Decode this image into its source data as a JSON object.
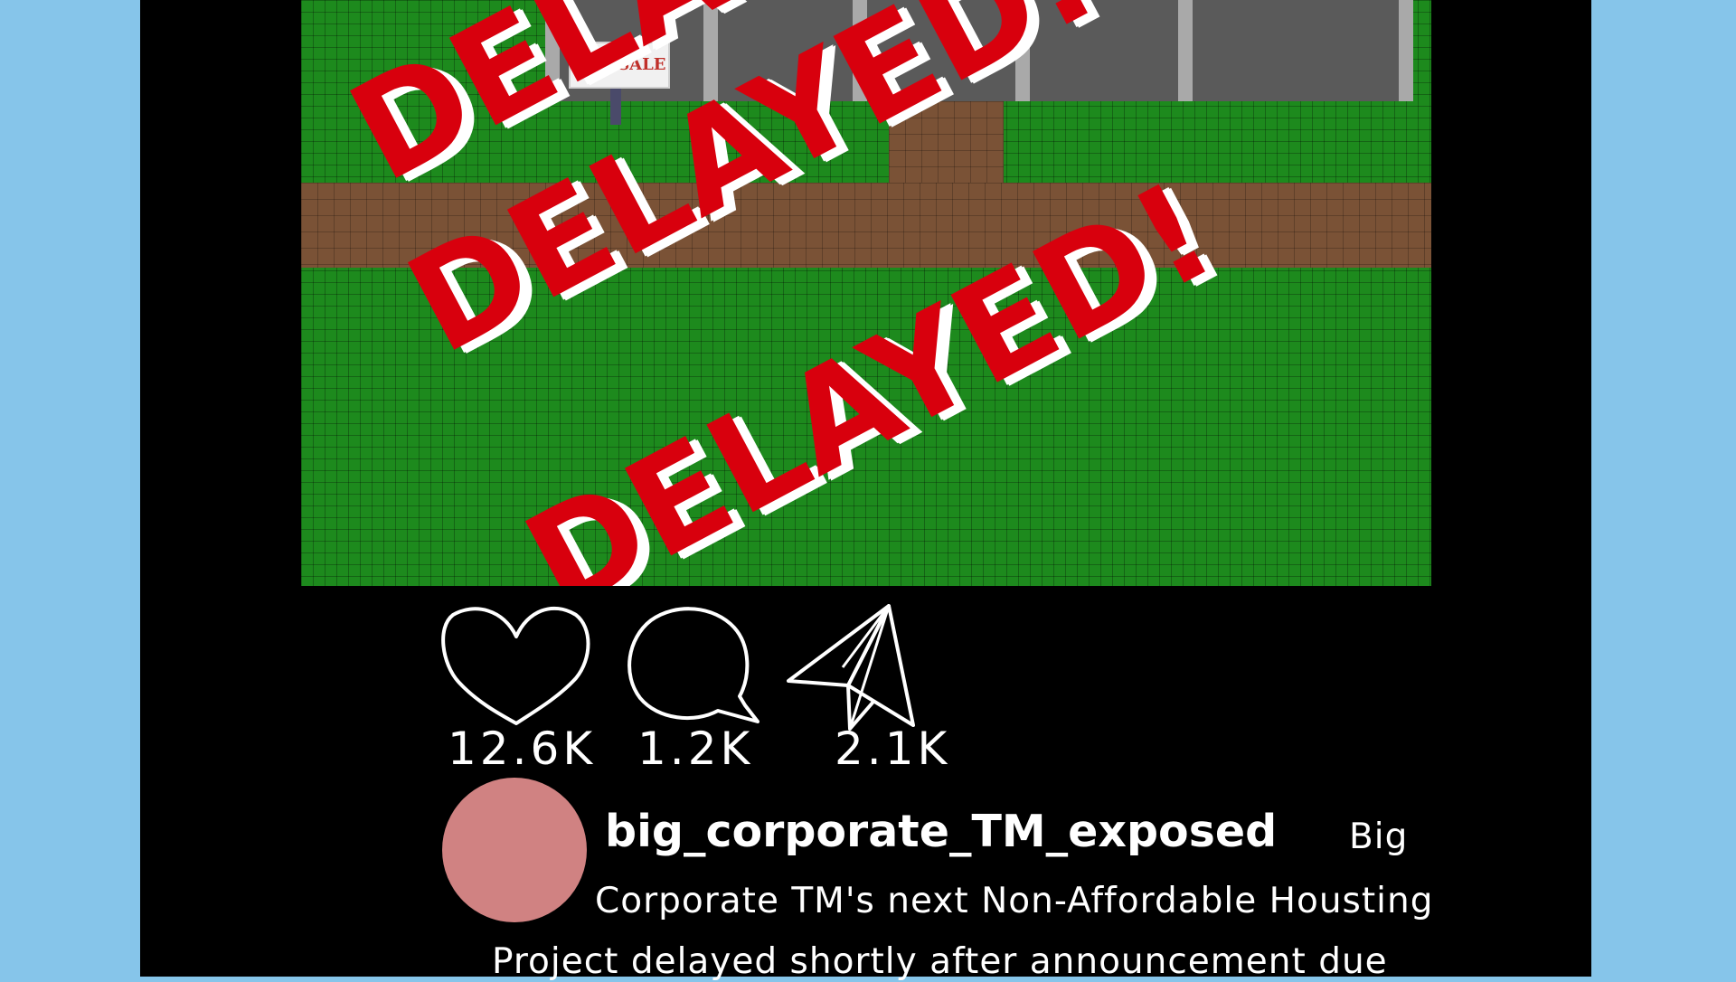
{
  "post": {
    "image": {
      "sign_text": "FOR SALE",
      "stamp_lines": [
        "DELAYED!",
        "DELAYED!",
        "DELAYED!"
      ]
    },
    "actions": {
      "like": {
        "icon": "heart-outline-icon",
        "count": "12.6K"
      },
      "comment": {
        "icon": "speech-bubble-icon",
        "count": "1.2K"
      },
      "share": {
        "icon": "paper-plane-icon",
        "count": "2.1K"
      }
    },
    "author": {
      "username": "big_corporate_TM_exposed",
      "avatar_color": "#d08282"
    },
    "caption_lines": [
      "Big",
      "Corporate TM's next Non-Affordable Housting",
      "Project delayed shortly after announcement due"
    ]
  },
  "colors": {
    "background": "#86c5ea",
    "phone": "#000000",
    "grass": "#1d8a1d",
    "stamp": "#d8000d"
  }
}
